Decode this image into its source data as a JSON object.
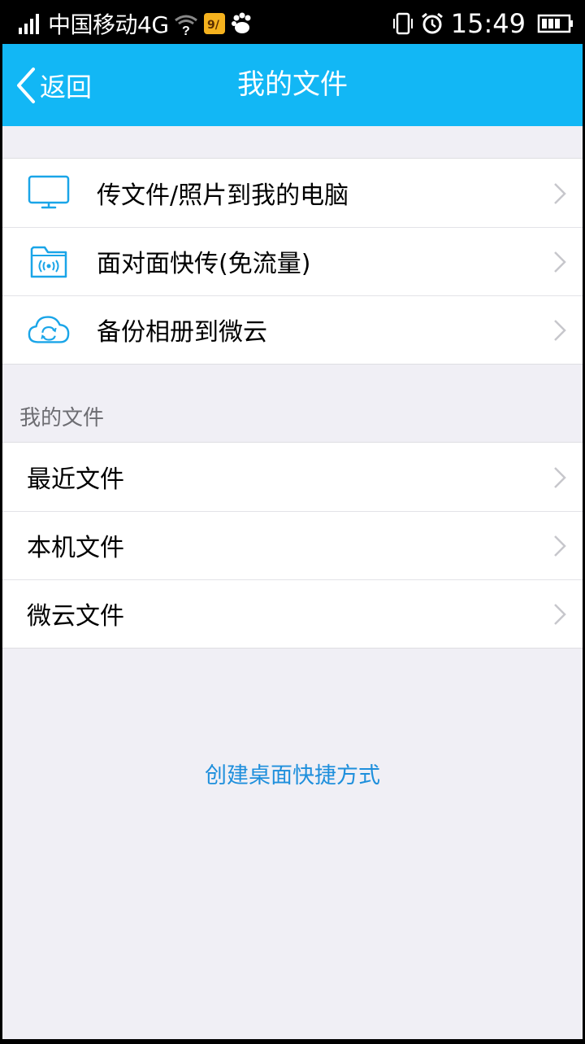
{
  "status_bar": {
    "network_badge": "4G",
    "carrier": "中国移动4G",
    "time": "15:49",
    "icons": [
      "signal-icon",
      "wifi-icon",
      "qq-notification-icon",
      "baidu-icon",
      "vibrate-icon",
      "alarm-icon",
      "battery-icon"
    ]
  },
  "nav": {
    "back_label": "返回",
    "title": "我的文件"
  },
  "top_group": {
    "items": [
      {
        "label": "传文件/照片到我的电脑",
        "icon": "computer-icon"
      },
      {
        "label": "面对面快传(免流量)",
        "icon": "folder-wireless-icon"
      },
      {
        "label": "备份相册到微云",
        "icon": "cloud-sync-icon"
      }
    ]
  },
  "files_section": {
    "header": "我的文件",
    "items": [
      {
        "label": "最近文件"
      },
      {
        "label": "本机文件"
      },
      {
        "label": "微云文件"
      }
    ]
  },
  "footer": {
    "shortcut_label": "创建桌面快捷方式"
  },
  "colors": {
    "nav_bg": "#12b7f5",
    "icon_blue": "#1aa5e8",
    "link_blue": "#1e8fdc",
    "page_bg": "#f0eff5"
  }
}
